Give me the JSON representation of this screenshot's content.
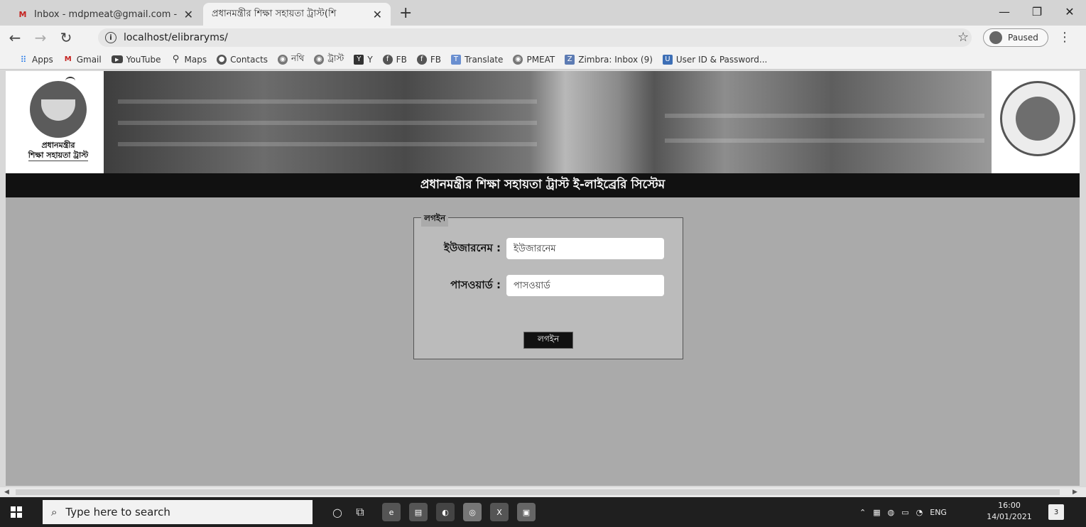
{
  "browser": {
    "tabs": [
      {
        "title": "Inbox - mdpmeat@gmail.com -",
        "icon": "gmail-icon"
      },
      {
        "title": "প্রধানমন্ত্রীর শিক্ষা সহায়তা ট্রাস্ট(শি",
        "icon": "page-icon"
      }
    ],
    "url": "localhost/elibraryms/",
    "profile_label": "Paused",
    "bookmarks": [
      {
        "label": "Apps",
        "icon": "apps-grid-icon"
      },
      {
        "label": "Gmail",
        "icon": "gmail-icon"
      },
      {
        "label": "YouTube",
        "icon": "youtube-icon"
      },
      {
        "label": "Maps",
        "icon": "maps-icon"
      },
      {
        "label": "Contacts",
        "icon": "contacts-icon"
      },
      {
        "label": "নথি",
        "icon": "circle-icon"
      },
      {
        "label": "ট্রাস্ট",
        "icon": "circle-icon"
      },
      {
        "label": "Y",
        "icon": "y-icon"
      },
      {
        "label": "FB",
        "icon": "facebook-icon"
      },
      {
        "label": "FB",
        "icon": "facebook-icon"
      },
      {
        "label": "Translate",
        "icon": "translate-icon"
      },
      {
        "label": "PMEAT",
        "icon": "circle-icon"
      },
      {
        "label": "Zimbra: Inbox (9)",
        "icon": "zimbra-icon"
      },
      {
        "label": "User ID & Password...",
        "icon": "user-icon"
      }
    ]
  },
  "site": {
    "logo_text_line1": "প্রধানমন্ত্রীর",
    "logo_text_line2": "শিক্ষা সহায়তা ট্রাস্ট",
    "title": "প্রধানমন্ত্রীর শিক্ষা সহায়তা ট্রাস্ট ই-লাইব্রেরি সিস্টেম"
  },
  "login": {
    "legend": "লগইন",
    "username_label": "ইউজারনেম :",
    "username_placeholder": "ইউজারনেম",
    "password_label": "পাসওয়ার্ড :",
    "password_placeholder": "পাসওয়ার্ড",
    "submit_label": "লগইন"
  },
  "taskbar": {
    "search_placeholder": "Type here to search",
    "language": "ENG",
    "time": "16:00",
    "date": "14/01/2021",
    "notification_count": "3"
  }
}
